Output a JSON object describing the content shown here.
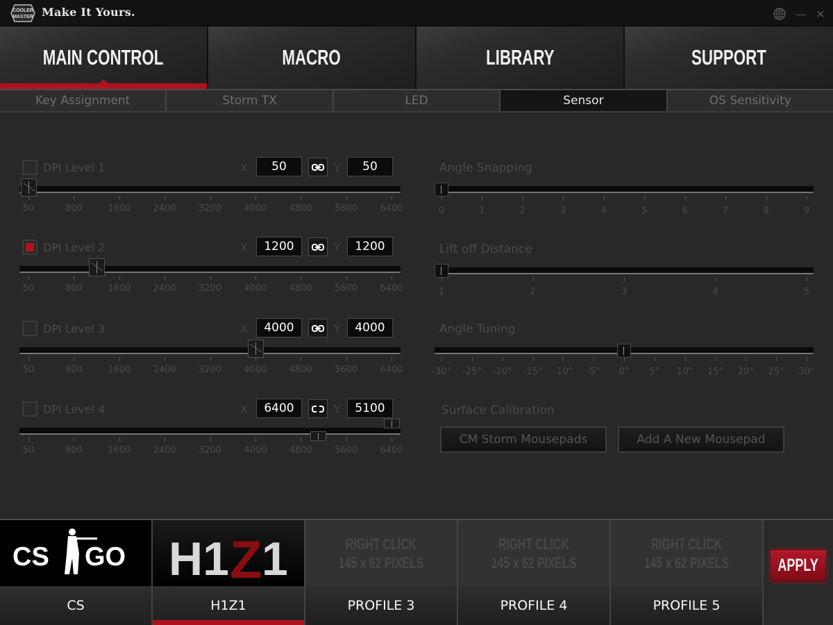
{
  "titlebar": {
    "logo": "cooler-master-logo",
    "brand": "Make It Yours.",
    "buttons": {
      "language": "globe-icon",
      "minimize": "minimize-icon",
      "close": "close-icon",
      "minimize_glyph": "—",
      "close_glyph": "✕"
    }
  },
  "main_nav": {
    "tabs": [
      {
        "label": "MAIN CONTROL",
        "active": true
      },
      {
        "label": "MACRO",
        "active": false
      },
      {
        "label": "LIBRARY",
        "active": false
      },
      {
        "label": "SUPPORT",
        "active": false
      }
    ]
  },
  "sub_nav": {
    "tabs": [
      {
        "label": "Key Assignment",
        "active": false
      },
      {
        "label": "Storm TX",
        "active": false
      },
      {
        "label": "LED",
        "active": false
      },
      {
        "label": "Sensor",
        "active": true
      },
      {
        "label": "OS Sensitivity",
        "active": false
      }
    ]
  },
  "dpi": {
    "axis_x": "X",
    "axis_y": "Y",
    "scale": {
      "min": 50,
      "max": 6400,
      "ticks": [
        "50",
        "800",
        "1600",
        "2400",
        "3200",
        "4000",
        "4800",
        "5600",
        "6400"
      ]
    },
    "levels": [
      {
        "label": "DPI Level 1",
        "checked": false,
        "x": "50",
        "y": "50",
        "linked": true
      },
      {
        "label": "DPI Level 2",
        "checked": true,
        "x": "1200",
        "y": "1200",
        "linked": true
      },
      {
        "label": "DPI Level 3",
        "checked": false,
        "x": "4000",
        "y": "4000",
        "linked": true
      },
      {
        "label": "DPI Level 4",
        "checked": false,
        "x": "6400",
        "y": "5100",
        "linked": false
      }
    ]
  },
  "sensor": {
    "angle_snapping": {
      "title": "Angle Snapping",
      "value": 0,
      "min": 0,
      "max": 9,
      "ticks": [
        "0",
        "1",
        "2",
        "3",
        "4",
        "5",
        "6",
        "7",
        "8",
        "9"
      ]
    },
    "lift_off": {
      "title": "Lift off Distance",
      "value": 1,
      "min": 1,
      "max": 5,
      "ticks": [
        "1",
        "2",
        "3",
        "4",
        "5"
      ]
    },
    "angle_tuning": {
      "title": "Angle Tuning",
      "value": 0,
      "min": -30,
      "max": 30,
      "ticks": [
        "-30°",
        "-25°",
        "-20°",
        "-15°",
        "-10°",
        "-5°",
        "0°",
        "5°",
        "10°",
        "15°",
        "20°",
        "25°",
        "30°"
      ]
    },
    "surface_calibration": {
      "title": "Surface Calibration",
      "buttons": [
        "CM Storm Mousepads",
        "Add A New Mousepad"
      ]
    }
  },
  "profiles": {
    "items": [
      {
        "name": "CS",
        "image": "CS:GO logo",
        "active": false,
        "placeholder": null
      },
      {
        "name": "H1Z1",
        "image": "H1Z1 logo",
        "active": true,
        "placeholder": null
      },
      {
        "name": "PROFILE 3",
        "active": false,
        "placeholder": [
          "RIGHT CLICK",
          "145 x 62 PIXELS"
        ]
      },
      {
        "name": "PROFILE 4",
        "active": false,
        "placeholder": [
          "RIGHT CLICK",
          "145 x 62 PIXELS"
        ]
      },
      {
        "name": "PROFILE 5",
        "active": false,
        "placeholder": [
          "RIGHT CLICK",
          "145 x 62 PIXELS"
        ]
      }
    ],
    "apply_label": "APPLY"
  },
  "colors": {
    "accent": "#b0131e",
    "background": "#282828"
  }
}
